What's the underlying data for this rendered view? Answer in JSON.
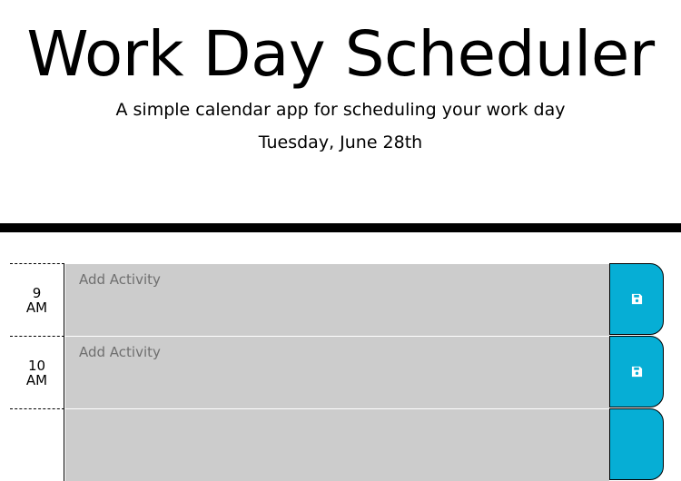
{
  "header": {
    "title": "Work Day Scheduler",
    "subtitle": "A simple calendar app for scheduling your work day",
    "current_day": "Tuesday, June 28th"
  },
  "time_blocks": [
    {
      "hour": "9",
      "period": "AM",
      "placeholder": "Add Activity",
      "save_icon": "floppy-disk-icon"
    },
    {
      "hour": "10",
      "period": "AM",
      "placeholder": "Add Activity",
      "save_icon": "floppy-disk-icon"
    }
  ],
  "colors": {
    "header_rule": "#000000",
    "textarea_bg": "#cccccc",
    "save_button": "#06aed5"
  }
}
